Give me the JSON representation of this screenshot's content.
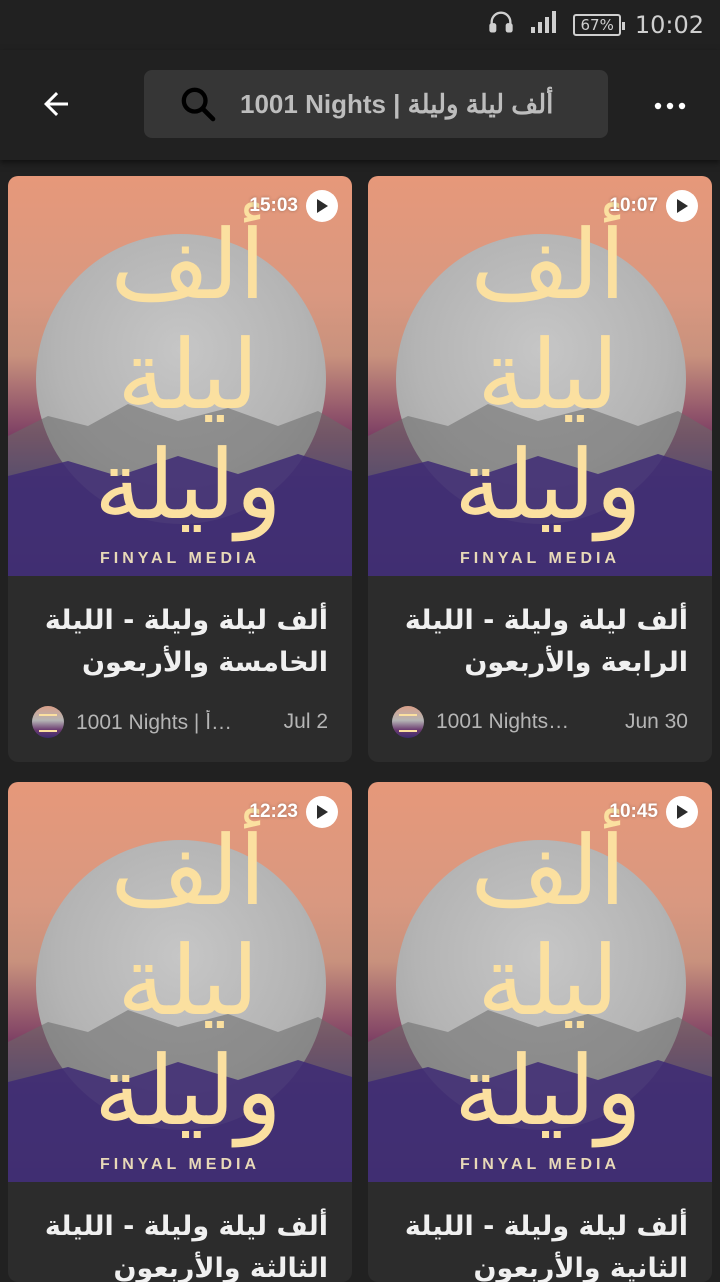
{
  "status_bar": {
    "battery": "67%",
    "time": "10:02"
  },
  "app_bar": {
    "search_text": "1001 Nights | ألف ليلة وليلة"
  },
  "episodes": [
    {
      "duration": "15:03",
      "title": "ألف ليلة وليلة - الليلة الخامسة والأربعون",
      "podcast": "1001 Nights | أ…",
      "date": "Jul 2",
      "cover_text": "ألف ليلة وليلة",
      "brand": "FINYAL MEDIA"
    },
    {
      "duration": "10:07",
      "title": "ألف ليلة وليلة - الليلة الرابعة والأربعون",
      "podcast": "1001 Nights…",
      "date": "Jun 30",
      "cover_text": "ألف ليلة وليلة",
      "brand": "FINYAL MEDIA"
    },
    {
      "duration": "12:23",
      "title": "ألف ليلة وليلة - الليلة الثالثة والأربعون",
      "cover_text": "ألف ليلة وليلة",
      "brand": "FINYAL MEDIA"
    },
    {
      "duration": "10:45",
      "title": "ألف ليلة وليلة - الليلة الثانية والأربعون",
      "cover_text": "ألف ليلة وليلة",
      "brand": "FINYAL MEDIA"
    }
  ],
  "icons": {
    "back": "arrow-left-icon",
    "search": "search-icon",
    "more": "more-vert-icon",
    "headset": "headset-icon",
    "signal": "signal-icon",
    "play": "play-icon"
  },
  "colors": {
    "background": "#212121",
    "card": "#2c2c2c",
    "search_box": "#363636",
    "cover_text": "#fbe0a0"
  }
}
